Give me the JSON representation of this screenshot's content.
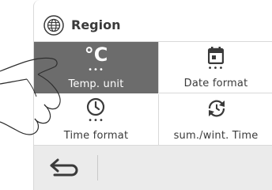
{
  "header": {
    "title": "Region",
    "icon": "globe-icon"
  },
  "tiles": {
    "temp_unit": {
      "symbol": "°C",
      "label": "Temp. unit",
      "selected": true
    },
    "date_format": {
      "label": "Date format",
      "icon": "calendar-icon"
    },
    "time_format": {
      "label": "Time format",
      "icon": "clock-icon"
    },
    "summer_winter_time": {
      "label": "sum./wint. Time",
      "icon": "clock-arrows-icon"
    }
  },
  "footer": {
    "back_icon": "back-arrow-icon"
  },
  "colors": {
    "selected_tile": "#6c6c6c",
    "text": "#3a3a3a",
    "footer_bg": "#ebebeb"
  }
}
